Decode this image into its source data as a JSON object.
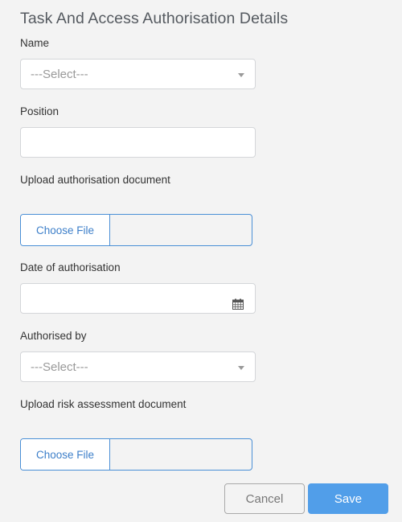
{
  "form": {
    "title": "Task And Access Authorisation Details",
    "name": {
      "label": "Name",
      "placeholder": "---Select---"
    },
    "position": {
      "label": "Position",
      "value": ""
    },
    "upload_authorisation": {
      "label": "Upload authorisation document",
      "button": "Choose File",
      "filename": ""
    },
    "date_of_authorisation": {
      "label": "Date of authorisation",
      "value": "",
      "icon": "calendar-icon"
    },
    "authorised_by": {
      "label": "Authorised by",
      "placeholder": "---Select---"
    },
    "upload_risk_assessment": {
      "label": "Upload risk assessment document",
      "button": "Choose File",
      "filename": ""
    }
  },
  "actions": {
    "cancel_label": "Cancel",
    "save_label": "Save"
  },
  "colors": {
    "accent": "#519ee9",
    "file_border": "#4a8fd6"
  }
}
